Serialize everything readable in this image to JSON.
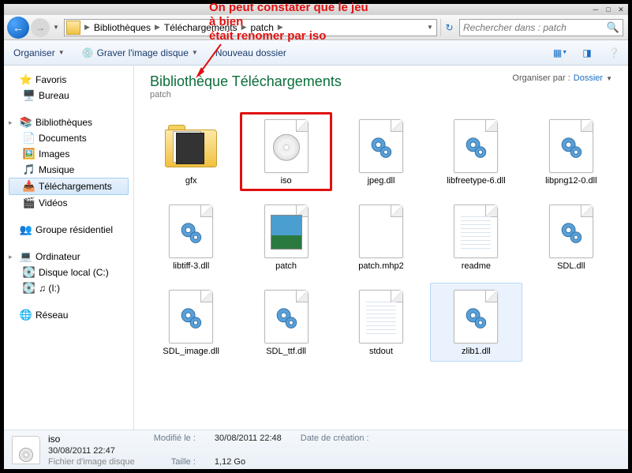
{
  "breadcrumb": [
    "Bibliothèques",
    "Téléchargements",
    "patch"
  ],
  "search": {
    "placeholder": "Rechercher dans : patch"
  },
  "toolbar": {
    "organize": "Organiser",
    "burn": "Graver l'image disque",
    "newfolder": "Nouveau dossier"
  },
  "annotation": {
    "line1": "On peut constater que le jeu",
    "line2": "à bien",
    "line3": "était renomer par iso"
  },
  "sidebar": {
    "favorites": {
      "label": "Favoris",
      "items": [
        "Bureau"
      ]
    },
    "libraries": {
      "label": "Bibliothèques",
      "items": [
        "Documents",
        "Images",
        "Musique",
        "Téléchargements",
        "Vidéos"
      ]
    },
    "homegroup": "Groupe résidentiel",
    "computer": {
      "label": "Ordinateur",
      "items": [
        "Disque local (C:)",
        "♫ (I:)"
      ]
    },
    "network": "Réseau"
  },
  "library": {
    "title": "Bibliothèque Téléchargements",
    "subtitle": "patch",
    "arrange_label": "Organiser par :",
    "arrange_value": "Dossier"
  },
  "files": [
    {
      "name": "gfx",
      "type": "folder"
    },
    {
      "name": "iso",
      "type": "disc",
      "highlight": "red"
    },
    {
      "name": "jpeg.dll",
      "type": "gear"
    },
    {
      "name": "libfreetype-6.dll",
      "type": "gear"
    },
    {
      "name": "libpng12-0.dll",
      "type": "gear"
    },
    {
      "name": "libtiff-3.dll",
      "type": "gear"
    },
    {
      "name": "patch",
      "type": "pic"
    },
    {
      "name": "patch.mhp2",
      "type": "blank"
    },
    {
      "name": "readme",
      "type": "text"
    },
    {
      "name": "SDL.dll",
      "type": "gear"
    },
    {
      "name": "SDL_image.dll",
      "type": "gear"
    },
    {
      "name": "SDL_ttf.dll",
      "type": "gear"
    },
    {
      "name": "stdout",
      "type": "text"
    },
    {
      "name": "zlib1.dll",
      "type": "gear",
      "highlight": "blue"
    }
  ],
  "details": {
    "name": "iso",
    "type": "Fichier d'image disque",
    "modified_label": "Modifié le :",
    "modified": "30/08/2011 22:48",
    "size_label": "Taille :",
    "size": "1,12 Go",
    "created_label": "Date de création :",
    "created": "30/08/2011 22:47"
  }
}
